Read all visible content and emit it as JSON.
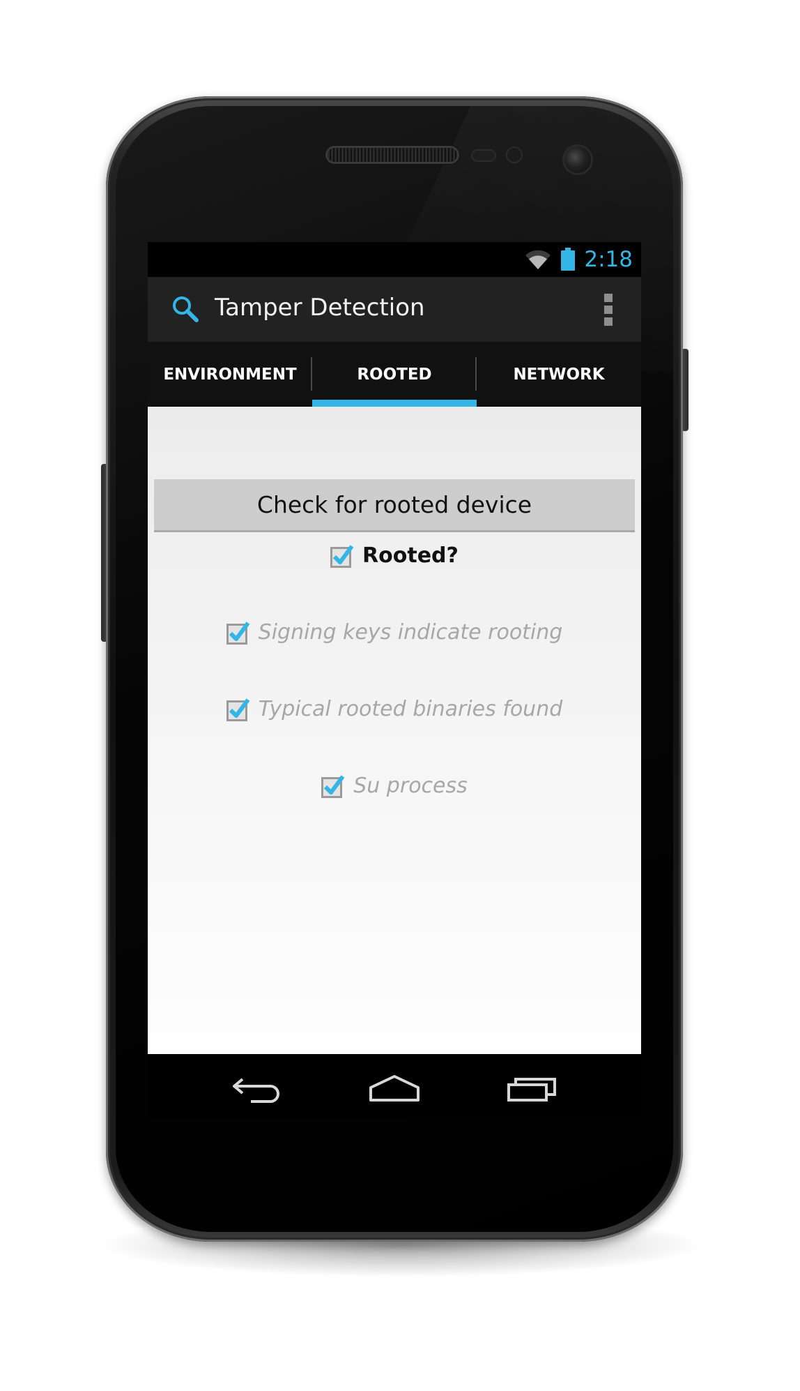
{
  "status_bar": {
    "time": "2:18",
    "icons": [
      "wifi-icon",
      "battery-icon"
    ],
    "accent_color": "#33b5e5"
  },
  "action_bar": {
    "app_icon": "search-icon",
    "title": "Tamper Detection",
    "overflow_icon": "overflow-menu-icon"
  },
  "tabs": [
    {
      "label": "ENVIRONMENT",
      "selected": false
    },
    {
      "label": "ROOTED",
      "selected": true
    },
    {
      "label": "NETWORK",
      "selected": false
    }
  ],
  "main": {
    "check_button_label": "Check for rooted device",
    "checks": [
      {
        "label": "Rooted?",
        "checked": true,
        "style": "primary"
      },
      {
        "label": "Signing keys indicate rooting",
        "checked": true,
        "style": "secondary"
      },
      {
        "label": "Typical rooted binaries found",
        "checked": true,
        "style": "secondary"
      },
      {
        "label": "Su process",
        "checked": true,
        "style": "secondary"
      }
    ]
  },
  "nav_bar": {
    "buttons": [
      "back-icon",
      "home-icon",
      "recent-apps-icon"
    ]
  },
  "colors": {
    "accent": "#33b5e5",
    "action_bar": "#222222",
    "tab_bar": "#111111",
    "button": "#cdcdcd"
  }
}
